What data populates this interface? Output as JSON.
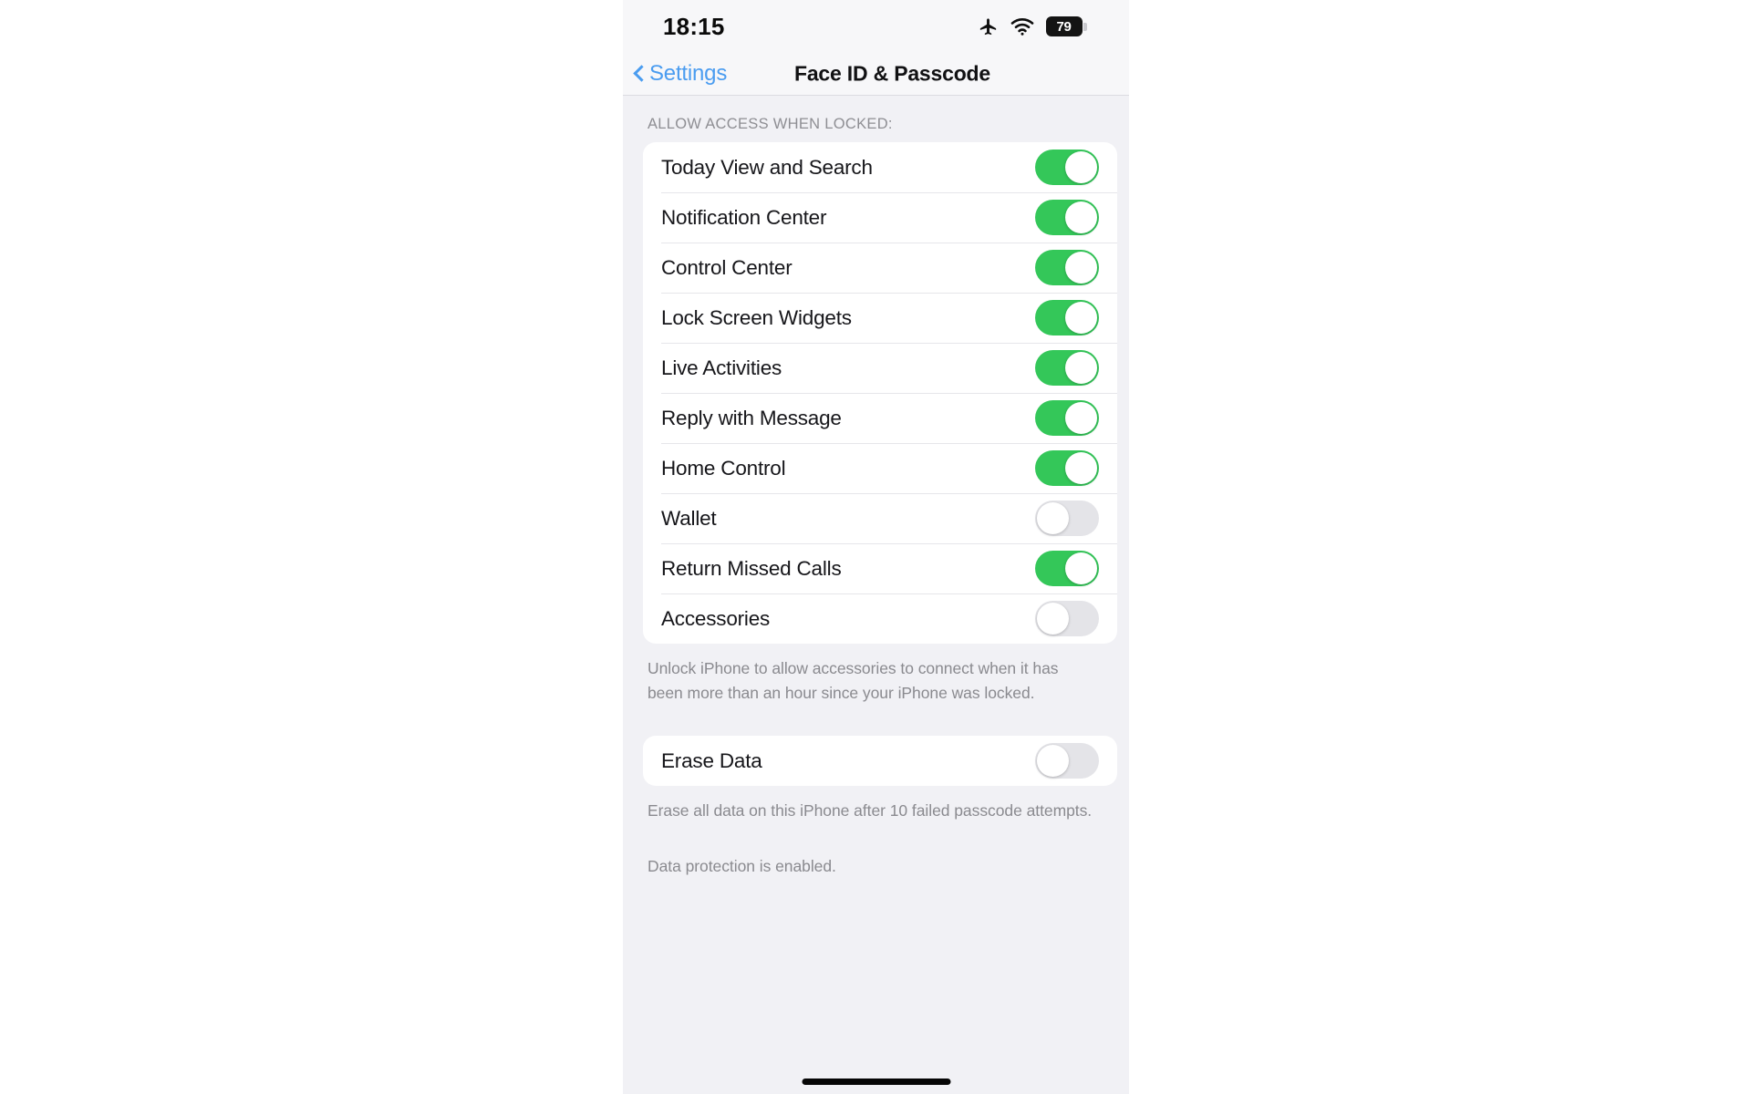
{
  "status_bar": {
    "time": "18:15",
    "airplane_icon": "airplane-icon",
    "wifi_icon": "wifi-icon",
    "battery_percent": "79"
  },
  "nav": {
    "back_label": "Settings",
    "back_icon": "chevron-left-icon",
    "title": "Face ID & Passcode"
  },
  "allow_access_section": {
    "header": "ALLOW ACCESS WHEN LOCKED:",
    "rows": [
      {
        "label": "Today View and Search",
        "enabled": true
      },
      {
        "label": "Notification Center",
        "enabled": true
      },
      {
        "label": "Control Center",
        "enabled": true
      },
      {
        "label": "Lock Screen Widgets",
        "enabled": true
      },
      {
        "label": "Live Activities",
        "enabled": true
      },
      {
        "label": "Reply with Message",
        "enabled": true
      },
      {
        "label": "Home Control",
        "enabled": true
      },
      {
        "label": "Wallet",
        "enabled": false
      },
      {
        "label": "Return Missed Calls",
        "enabled": true
      },
      {
        "label": "Accessories",
        "enabled": false
      }
    ],
    "footnote": "Unlock iPhone to allow accessories to connect when it has been more than an hour since your iPhone was locked."
  },
  "erase_data_section": {
    "rows": [
      {
        "label": "Erase Data",
        "enabled": false
      }
    ],
    "footnote": "Erase all data on this iPhone after 10 failed passcode attempts.",
    "status_note": "Data protection is enabled."
  },
  "colors": {
    "accent_blue": "#4a9cf0",
    "toggle_on_green": "#34c759",
    "toggle_off_gray": "#e4e4e8",
    "page_background": "#f1f1f5",
    "card_background": "#ffffff",
    "secondary_text": "#8e8e93"
  }
}
